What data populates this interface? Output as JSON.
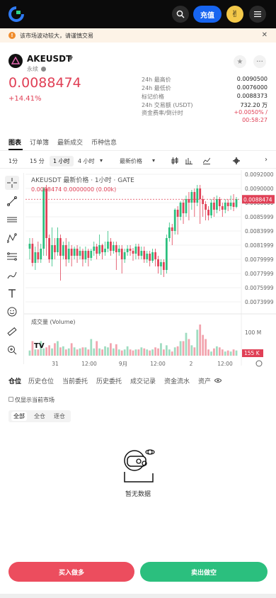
{
  "topbar": {
    "deposit_label": "充值"
  },
  "notice": {
    "text": "该市场波动较大，请谨慎交易",
    "close": "✕"
  },
  "header": {
    "symbol": "AKEUSDT",
    "sub": "永续",
    "price": "0.0088474",
    "change": "+14.41%",
    "stats": [
      {
        "label": "24h 最高价",
        "value": "0.0090500"
      },
      {
        "label": "24h 最低价",
        "value": "0.0076000"
      },
      {
        "label": "标记价格",
        "value": "0.0088373"
      },
      {
        "label": "24h 交易额 (USDT)",
        "value": "732.20 万"
      },
      {
        "label": "资金费率/倒计时",
        "value": "+0.0050% /"
      }
    ],
    "countdown": "00:58:27"
  },
  "tabs": [
    "图表",
    "订单簿",
    "最新成交",
    "币种信息"
  ],
  "timeframes": {
    "t1": "1分",
    "t2": "15 分",
    "t3": "1 小时",
    "t4": "4 小时",
    "price_type": "最新价格"
  },
  "chart": {
    "title": "AKEUSDT 最新价格 · 1小时 · GATE",
    "values": "0.0088474  0.0000000 (0.00k)",
    "volume_label": "成交量 (Volume)",
    "badge_price": "0.0088474",
    "badge_vol": "155 K",
    "vol_tick": "100 M"
  },
  "chart_data": {
    "type": "candlestick",
    "title": "AKEUSDT 最新价格 · 1小时 · GATE",
    "y_ticks": [
      "0.0092000",
      "0.0090000",
      "0.0088000",
      "0.0085999",
      "0.0083999",
      "0.0081999",
      "0.0079999",
      "0.0077999",
      "0.0075999",
      "0.0073999"
    ],
    "x_ticks": [
      "31",
      "12:00",
      "9月",
      "12:00",
      "2",
      "12:00"
    ],
    "last_price": 0.0088474,
    "y_range": [
      0.0073,
      0.0092
    ],
    "candles": [
      [
        0.00815,
        0.00822,
        0.008,
        0.0083
      ],
      [
        0.00822,
        0.00795,
        0.0079,
        0.0083
      ],
      [
        0.00795,
        0.0081,
        0.00785,
        0.00818
      ],
      [
        0.0081,
        0.008,
        0.00795,
        0.00825
      ],
      [
        0.008,
        0.00815,
        0.00795,
        0.00822
      ],
      [
        0.00815,
        0.009,
        0.00805,
        0.00902
      ],
      [
        0.009,
        0.0083,
        0.00805,
        0.00905
      ],
      [
        0.0083,
        0.008,
        0.00795,
        0.00835
      ],
      [
        0.008,
        0.0082,
        0.0079,
        0.00845
      ],
      [
        0.0082,
        0.0081,
        0.008,
        0.0083
      ],
      [
        0.0081,
        0.0083,
        0.00805,
        0.00845
      ],
      [
        0.0083,
        0.00805,
        0.0077,
        0.00835
      ],
      [
        0.00805,
        0.0082,
        0.008,
        0.00825
      ],
      [
        0.0082,
        0.008,
        0.0079,
        0.0083
      ],
      [
        0.008,
        0.00815,
        0.00795,
        0.00825
      ],
      [
        0.00815,
        0.00805,
        0.0079,
        0.0082
      ],
      [
        0.00805,
        0.00815,
        0.008,
        0.00818
      ],
      [
        0.00815,
        0.00805,
        0.00795,
        0.0082
      ],
      [
        0.00805,
        0.00812,
        0.008,
        0.00818
      ],
      [
        0.00812,
        0.008,
        0.0079,
        0.00815
      ],
      [
        0.008,
        0.00812,
        0.00795,
        0.00818
      ],
      [
        0.00812,
        0.00802,
        0.0079,
        0.00815
      ],
      [
        0.00802,
        0.00812,
        0.00798,
        0.00815
      ],
      [
        0.00812,
        0.00818,
        0.00805,
        0.00825
      ],
      [
        0.00818,
        0.00808,
        0.008,
        0.00822
      ],
      [
        0.00808,
        0.0082,
        0.00805,
        0.00835
      ],
      [
        0.0082,
        0.0081,
        0.008,
        0.00822
      ],
      [
        0.0081,
        0.00815,
        0.00805,
        0.00825
      ],
      [
        0.00815,
        0.00825,
        0.0081,
        0.0084
      ],
      [
        0.00825,
        0.00812,
        0.00805,
        0.0083
      ],
      [
        0.00812,
        0.0082,
        0.00808,
        0.00825
      ],
      [
        0.0082,
        0.0081,
        0.00785,
        0.00825
      ],
      [
        0.0081,
        0.00815,
        0.00805,
        0.0082
      ],
      [
        0.00815,
        0.008,
        0.0078,
        0.0082
      ],
      [
        0.008,
        0.0081,
        0.00795,
        0.00815
      ],
      [
        0.0081,
        0.00815,
        0.00805,
        0.0082
      ],
      [
        0.00815,
        0.00812,
        0.00805,
        0.0082
      ],
      [
        0.00812,
        0.00808,
        0.00798,
        0.00816
      ],
      [
        0.00808,
        0.00818,
        0.008,
        0.00822
      ],
      [
        0.00818,
        0.00805,
        0.008,
        0.00822
      ],
      [
        0.00805,
        0.00812,
        0.008,
        0.00818
      ],
      [
        0.00812,
        0.008,
        0.00795,
        0.00818
      ],
      [
        0.008,
        0.00808,
        0.00795,
        0.00812
      ],
      [
        0.00808,
        0.00798,
        0.0079,
        0.00812
      ],
      [
        0.00798,
        0.0081,
        0.00795,
        0.00815
      ],
      [
        0.0081,
        0.008,
        0.0079,
        0.00815
      ],
      [
        0.008,
        0.0079,
        0.0078,
        0.00805
      ],
      [
        0.0079,
        0.00796,
        0.00778,
        0.008
      ],
      [
        0.00796,
        0.00785,
        0.00775,
        0.008
      ],
      [
        0.00785,
        0.0083,
        0.0078,
        0.00835
      ],
      [
        0.0083,
        0.00845,
        0.00825,
        0.00852
      ],
      [
        0.00845,
        0.0084,
        0.0082,
        0.0085
      ],
      [
        0.0084,
        0.0087,
        0.00835,
        0.00872
      ],
      [
        0.0087,
        0.0086,
        0.00835,
        0.00875
      ],
      [
        0.0086,
        0.0088,
        0.00855,
        0.00882
      ],
      [
        0.0088,
        0.00865,
        0.0085,
        0.00885
      ],
      [
        0.00865,
        0.00885,
        0.0086,
        0.0089
      ],
      [
        0.00885,
        0.0088,
        0.00855,
        0.00895
      ],
      [
        0.0088,
        0.00895,
        0.0087,
        0.00898
      ],
      [
        0.00895,
        0.0088,
        0.0086,
        0.009
      ],
      [
        0.0088,
        0.009,
        0.00875,
        0.00905
      ],
      [
        0.009,
        0.00885,
        0.0085,
        0.00905
      ],
      [
        0.00885,
        0.00878,
        0.0086,
        0.0089
      ],
      [
        0.00878,
        0.0087,
        0.00855,
        0.00882
      ],
      [
        0.0087,
        0.00862,
        0.00855,
        0.00875
      ],
      [
        0.00862,
        0.0088,
        0.00858,
        0.00885
      ],
      [
        0.0088,
        0.0087,
        0.0086,
        0.00888
      ],
      [
        0.0087,
        0.00885,
        0.00865,
        0.0089
      ],
      [
        0.00885,
        0.00875,
        0.00868,
        0.00888
      ],
      [
        0.00875,
        0.0087,
        0.0086,
        0.0088
      ],
      [
        0.0087,
        0.0088,
        0.00865,
        0.00885
      ],
      [
        0.0088,
        0.00875,
        0.00868,
        0.00885
      ],
      [
        0.00875,
        0.0088,
        0.0087,
        0.0089
      ],
      [
        0.0088,
        0.00874,
        0.00868,
        0.00892
      ],
      [
        0.00874,
        0.00885,
        0.00872,
        0.00888
      ]
    ],
    "volumes": [
      5,
      14,
      6,
      6,
      14,
      7,
      8,
      10,
      7,
      12,
      14,
      8,
      9,
      6,
      7,
      12,
      8,
      6,
      7,
      8,
      8,
      6,
      16,
      7,
      14,
      7,
      6,
      9,
      8,
      12,
      7,
      11,
      6,
      5,
      6,
      9,
      6,
      5,
      6,
      6,
      8,
      7,
      6,
      5,
      6,
      8,
      7,
      12,
      6,
      10,
      6,
      4,
      8,
      9,
      14,
      14,
      22,
      16,
      10,
      8,
      25,
      30,
      20,
      16,
      6,
      4,
      7,
      9,
      8,
      6,
      4,
      5,
      4,
      6,
      5
    ]
  },
  "tabs2": [
    "仓位",
    "历史仓位",
    "当前委托",
    "历史委托",
    "成交记录",
    "资金流水",
    "资产"
  ],
  "filter": {
    "label": "仅显示当前市场",
    "all": "全部",
    "cross": "全仓",
    "isolated": "逐仓"
  },
  "empty": {
    "label": "暂无数据"
  },
  "actions": {
    "buy": "买入做多",
    "sell": "卖出做空"
  },
  "colors": {
    "up": "#e04056",
    "down": "#2bbf7e",
    "accent": "#1765f0"
  }
}
